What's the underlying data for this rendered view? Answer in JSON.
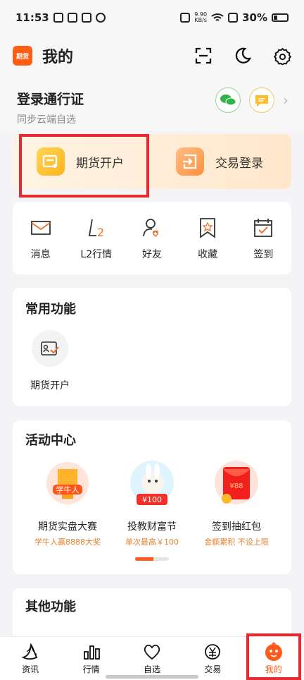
{
  "statusbar": {
    "time": "11:53",
    "net_speed_top": "9.90",
    "net_speed_bottom": "KB/s",
    "battery": "30%"
  },
  "header": {
    "logo_text": "期货",
    "title": "我的"
  },
  "login": {
    "title": "登录通行证",
    "subtitle": "同步云端自选"
  },
  "account": {
    "open_label": "期货开户",
    "trade_label": "交易登录"
  },
  "quick_actions": [
    {
      "label": "消息"
    },
    {
      "label": "L2行情"
    },
    {
      "label": "好友"
    },
    {
      "label": "收藏"
    },
    {
      "label": "签到"
    }
  ],
  "common": {
    "title": "常用功能",
    "items": [
      {
        "label": "期货开户"
      }
    ]
  },
  "activity": {
    "title": "活动中心",
    "items": [
      {
        "title": "期货实盘大赛",
        "subtitle": "学牛人赢8888大奖",
        "badge": "学牛人"
      },
      {
        "title": "投教财富节",
        "subtitle": "单次最高￥100",
        "badge": "¥100"
      },
      {
        "title": "签到抽红包",
        "subtitle": "金额累积 不设上限",
        "badge": "¥88"
      }
    ]
  },
  "other": {
    "title": "其他功能"
  },
  "nav": [
    {
      "label": "资讯"
    },
    {
      "label": "行情"
    },
    {
      "label": "自选"
    },
    {
      "label": "交易"
    },
    {
      "label": "我的"
    }
  ],
  "colors": {
    "accent": "#ff5a1a",
    "highlight": "#e52a33"
  }
}
